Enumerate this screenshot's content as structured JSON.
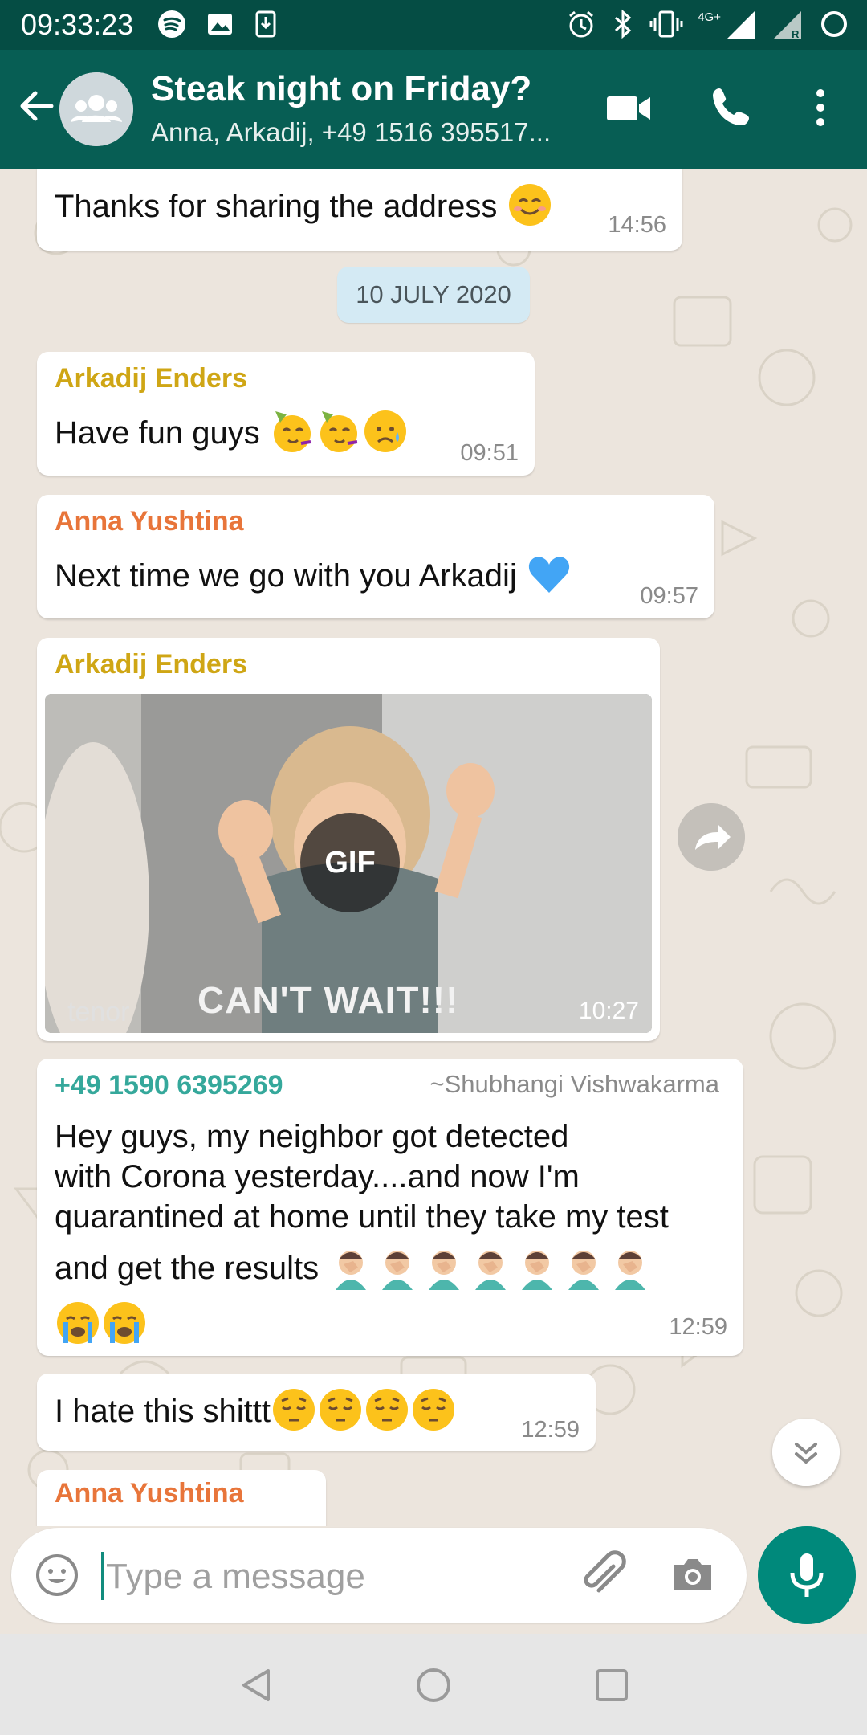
{
  "status_bar": {
    "time": "09:33:23",
    "network": "4G+",
    "sim_label": "R"
  },
  "header": {
    "title": "Steak night on Friday?",
    "subtitle": "Anna, Arkadij, +49 1516 395517..."
  },
  "messages": [
    {
      "text": "Thanks for sharing the address",
      "time": "14:56"
    },
    {
      "date": "10 JULY 2020"
    },
    {
      "sender": "Arkadij Enders",
      "text": "Have fun guys",
      "time": "09:51"
    },
    {
      "sender": "Anna Yushtina",
      "text": "Next time we go with you Arkadij",
      "time": "09:57"
    },
    {
      "sender": "Arkadij Enders",
      "gif_badge": "GIF",
      "gif_caption": "CAN'T WAIT!!!",
      "gif_watermark": "tenor",
      "time": "10:27"
    },
    {
      "sender": "+49 1590 6395269",
      "sender_name": "~Shubhangi Vishwakarma",
      "lines": [
        "Hey guys, my neighbor got detected",
        "with Corona yesterday....and now I'm",
        "quarantined at home until they take my test",
        "and get the results"
      ],
      "time": "12:59"
    },
    {
      "text": "I hate this shittt",
      "time": "12:59"
    },
    {
      "sender": "Anna Yushtina"
    }
  ],
  "composer": {
    "placeholder": "Type a message"
  },
  "colors": {
    "header": "#075e54",
    "status": "#054d44",
    "accent": "#00897b",
    "sender_yellow": "#cfa615",
    "sender_orange": "#e8753a",
    "sender_teal": "#35a89b"
  },
  "icons": [
    "back-arrow-icon",
    "group-avatar-icon",
    "video-call-icon",
    "phone-icon",
    "more-vert-icon",
    "forward-icon",
    "scroll-down-icon",
    "emoji-icon",
    "attach-icon",
    "camera-icon",
    "mic-icon"
  ]
}
